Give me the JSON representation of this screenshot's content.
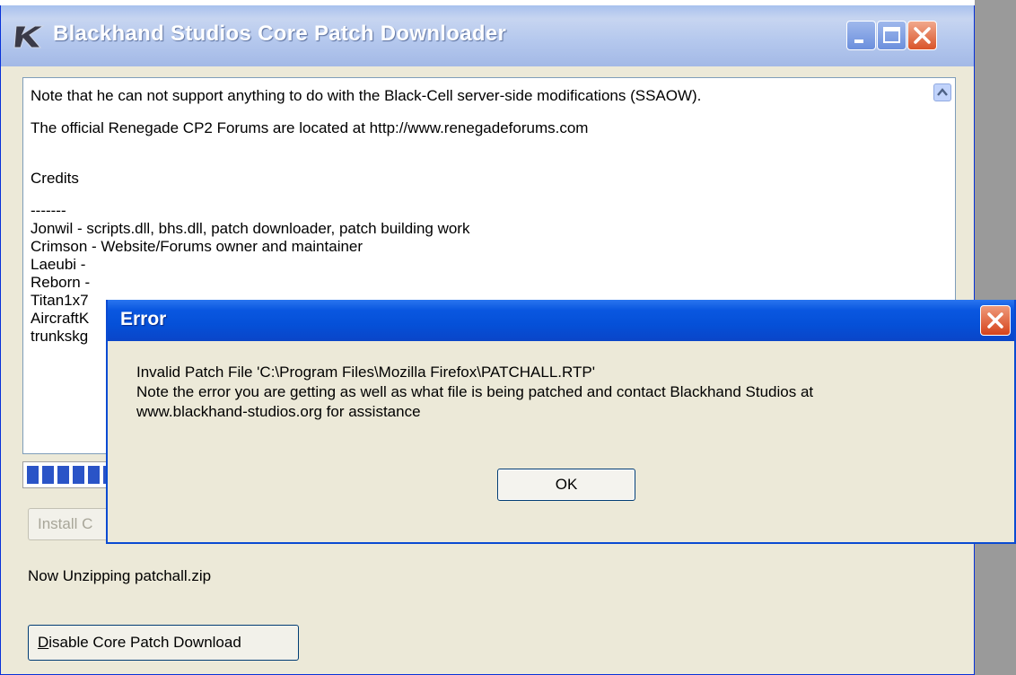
{
  "main_window": {
    "title": "Blackhand Studios Core Patch Downloader",
    "text_lines": [
      "Note that he can not support anything to do with the Black-Cell server-side modifications (SSAOW).",
      "The official Renegade CP2 Forums are located at http://www.renegadeforums.com",
      "",
      "Credits",
      "-------",
      "Jonwil - scripts.dll, bhs.dll, patch downloader, patch building work",
      "Crimson - Website/Forums owner and maintainer",
      "Laeubi -",
      "Reborn -",
      "Titan1x7",
      "AircraftK",
      "trunkskg"
    ],
    "progress": 0.1,
    "install_button_label": "Install C",
    "right_button_label": "",
    "status": "Now Unzipping patchall.zip",
    "disable_button": {
      "mnemonic": "D",
      "rest": "isable Core Patch Download"
    }
  },
  "error_dialog": {
    "title": "Error",
    "message_lines": [
      "Invalid Patch File 'C:\\Program Files\\Mozilla Firefox\\PATCHALL.RTP'",
      "Note the error you are getting as well as what file is being patched and contact Blackhand Studios at",
      "www.blackhand-studios.org for assistance"
    ],
    "ok_label": "OK"
  },
  "colors": {
    "dialog_title_bar": "#0550d8",
    "inactive_title_bar": "#b6c9ee",
    "window_face": "#ece9d8",
    "progress_fill": "#2a54c7"
  }
}
